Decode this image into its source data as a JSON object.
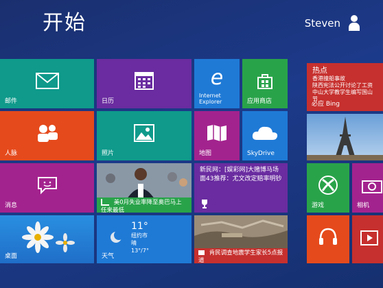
{
  "header": {
    "title": "开始",
    "user_name": "Steven"
  },
  "tiles": {
    "mail": {
      "label": "邮件"
    },
    "calendar": {
      "label": "日历"
    },
    "ie": {
      "label": "Internet Explorer"
    },
    "store": {
      "label": "应用商店"
    },
    "people": {
      "label": "人脉"
    },
    "photos": {
      "label": "照片"
    },
    "maps": {
      "label": "地图"
    },
    "skydrive": {
      "label": "SkyDrive"
    },
    "messaging": {
      "label": "消息"
    },
    "finance": {
      "headline": "美0月失业率降至奥巴马上任来最低"
    },
    "news": {
      "headline": "新民网：[娱彩网]大赌博马场面43推荐：尤文改定赔率明钞"
    },
    "desktop": {
      "label": "桌面"
    },
    "weather": {
      "temp": "11°",
      "city": "纽约市",
      "condition": "晴",
      "range": "13°/7°",
      "label": "天气"
    },
    "travel": {
      "headline": "肯民调查地震学生家长5点报道"
    },
    "bing": {
      "heading": "热点",
      "line1": "香港撞船事故",
      "line2": "陕西宪法公开讨论了工资",
      "line3": "中山大学教学生编写国山节",
      "label": "必应 Bing"
    },
    "games": {
      "label": "游戏"
    },
    "camera": {
      "label": "相机"
    }
  },
  "colors": {
    "teal": "#0f9a8b",
    "purple": "#6a2ca0",
    "blue": "#1f7ad6",
    "green": "#29a34a",
    "orange_red": "#e54a1c",
    "magenta": "#a3238e",
    "dark_red": "#c6302e"
  }
}
